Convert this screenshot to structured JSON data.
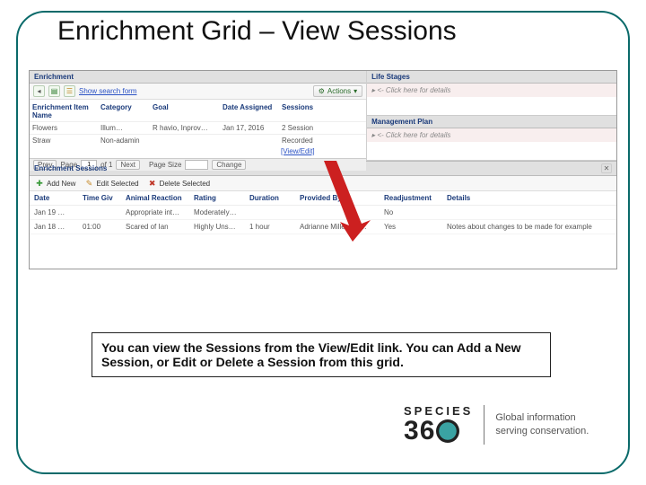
{
  "title": "Enrichment Grid – View Sessions",
  "enrichment": {
    "panel_title": "Enrichment",
    "search_link": "Show search form",
    "actions_label": "Actions",
    "columns": {
      "name": "Enrichment Item Name",
      "category": "Category",
      "goal": "Goal",
      "date": "Date Assigned",
      "sessions": "Sessions"
    },
    "rows": [
      {
        "name": "Flowers",
        "category": "Illum…",
        "goal": "R havio, Inprov…",
        "date": "Jan 17, 2016",
        "sessions": "2 Session"
      },
      {
        "name": "Straw",
        "category": "Non-adamin",
        "goal": "",
        "date": "",
        "sessions": "Recorded"
      }
    ],
    "view_edit": "[View/Edit]",
    "pager": {
      "prev": "Prev",
      "page_label": "Page",
      "page": "1",
      "of": "of 1",
      "next": "Next",
      "pagesize_label": "Page Size",
      "pagesize": "",
      "change": "Change"
    }
  },
  "life_stages": {
    "title": "Life Stages",
    "placeholder": "<- Click here for details"
  },
  "mgmt_plan": {
    "title": "Management Plan",
    "placeholder": "<- Click here for details"
  },
  "sessions": {
    "title": "Enrichment Sessions",
    "toolbar": {
      "add": "Add New",
      "edit": "Edit Selected",
      "del": "Delete Selected"
    },
    "columns": {
      "date": "Date",
      "time": "Time Giv",
      "react": "Animal Reaction",
      "rating": "Rating",
      "duration": "Duration",
      "provided": "Provided By",
      "readj": "Readjustment",
      "details": "Details"
    },
    "rows": [
      {
        "date": "Jan 19 …",
        "time": "",
        "react": "Appropriate int…",
        "rating": "Moderately…",
        "duration": "",
        "provided": "",
        "readj": "No",
        "details": ""
      },
      {
        "date": "Jan 18 …",
        "time": "01:00",
        "react": "Scared of Ian",
        "rating": "Highly Uns…",
        "duration": "1 hour",
        "provided": "Adrianne Miller, Es…",
        "readj": "Yes",
        "details": "Notes about changes to be made for example"
      }
    ]
  },
  "note": "You can view the Sessions from the View/Edit link. You can Add a New Session, or Edit or Delete a Session from this grid.",
  "logo": {
    "brand": "SPECIES",
    "tagline1": "Global information",
    "tagline2": "serving conservation."
  }
}
